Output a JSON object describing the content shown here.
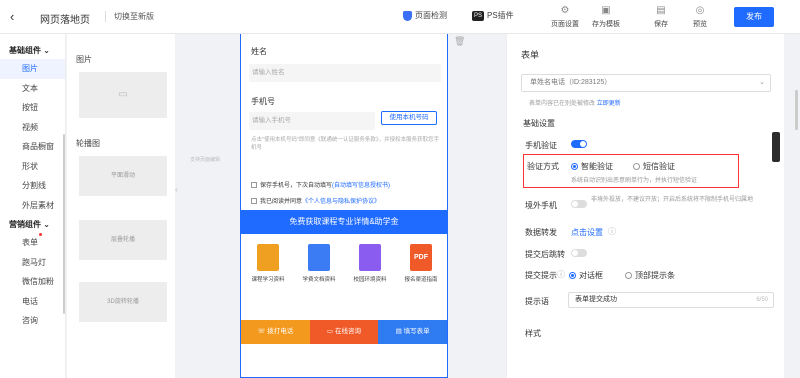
{
  "topbar": {
    "back_icon": "‹",
    "title": "网页落地页",
    "switch_old": "切换至新版",
    "check_label": "页面检测",
    "ps_badge": "PS",
    "ps_label": "PS插件",
    "tools": [
      {
        "icon": "gear-icon",
        "glyph": "⚙",
        "label": "页面设置"
      },
      {
        "icon": "template-icon",
        "glyph": "▣",
        "label": "存为模板"
      },
      {
        "icon": "save-icon",
        "glyph": "▤",
        "label": "保存"
      },
      {
        "icon": "eye-icon",
        "glyph": "◎",
        "label": "预览"
      }
    ],
    "publish": "发布"
  },
  "left_nav": {
    "group_basic": "基础组件",
    "basic_items": [
      "图片",
      "文本",
      "按钮",
      "视频",
      "商品橱窗",
      "形状",
      "分割线",
      "外层素材"
    ],
    "group_marketing": "营销组件",
    "marketing_items": [
      "表单",
      "跑马灯",
      "微信加粉",
      "电话",
      "咨询"
    ]
  },
  "components": {
    "images_label": "图片",
    "carousel_label": "轮播图",
    "thumbs": [
      "平面滑动",
      "层叠轮播",
      "3D旋转轮播"
    ],
    "collapse_glyph": "‹",
    "canvas_hint": "支持页面编辑"
  },
  "canvas": {
    "name_label": "姓名",
    "name_placeholder": "请输入姓名",
    "phone_label": "手机号",
    "phone_placeholder": "请输入手机号",
    "use_phone_btn": "使用本机号码",
    "note": "点击\"使用本机号码\"即同意《联通统一认证服务条款》，并授权本服务获取您手机号",
    "agree1_text": "保存手机号，下次自动填写",
    "agree1_link": "(自动填写信息授权书)",
    "agree2_text": "我已阅读并同意",
    "agree2_link": "《个人信息与隐私保护协议》",
    "submit": "免费获取课程专业详情&助学金",
    "docs": [
      {
        "label": "课程学习资料",
        "color": "#f0a020"
      },
      {
        "label": "学费文档资料",
        "color": "#3b7cf5"
      },
      {
        "label": "校园环境资料",
        "color": "#8a5cf0"
      },
      {
        "label": "报名渠道指南",
        "color": "#f05a28"
      }
    ],
    "pdf_text": "PDF",
    "bottom_buttons": [
      {
        "label": "拨打电话",
        "color": "#f39a1e"
      },
      {
        "label": "在线咨询",
        "color": "#f05a28"
      },
      {
        "label": "填写表单",
        "color": "#2f7bf2"
      }
    ],
    "trash_glyph": "🗑"
  },
  "right_panel": {
    "heading": "表单",
    "form_select": "单姓名电话（ID:283125）",
    "form_hint_text": "表单内容已在别处被修改",
    "form_hint_link": "立即更新",
    "basic_settings": "基础设置",
    "phone_verify": "手机验证",
    "verify_method": "验证方式",
    "option_smart": "智能验证",
    "option_sms": "短信验证",
    "verify_desc": "系统自动识别出恶意刷单行为，并执行短信验证",
    "outside_phone": "境外手机",
    "outside_desc": "非境外投放，不建议开放；开启后系统将不限制手机号归属地",
    "data_forward": "数据转发",
    "data_forward_link": "点击设置",
    "jump_after_submit": "提交后跳转",
    "submit_tip": "提交提示",
    "option_dialog": "对话框",
    "option_topbar": "顶部提示条",
    "tip_label": "提示语",
    "tip_value": "表单提交成功",
    "tip_count": "6/50",
    "style_heading": "样式",
    "accent_color": "#1f6aff",
    "highlight_color": "#ff3333"
  }
}
